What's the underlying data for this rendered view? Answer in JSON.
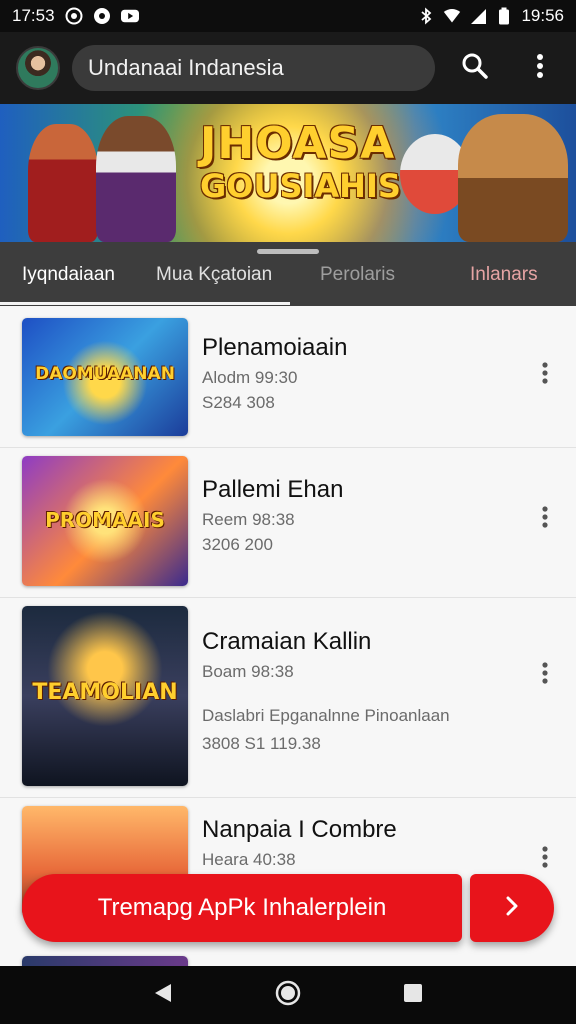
{
  "status_bar": {
    "time": "17:53",
    "battery": "19:56"
  },
  "app_bar": {
    "search_text": "Undanaai Indanesia"
  },
  "banner": {
    "title_line1": "JHOASA",
    "title_line2": "GOUSIAHIS"
  },
  "tabs": [
    {
      "label": "Iyqndaiaan",
      "active": true
    },
    {
      "label": "Mua Kçatoian",
      "active": false
    },
    {
      "label": "Perolaris",
      "active": false
    },
    {
      "label": "Inlanars",
      "active": false
    }
  ],
  "items": [
    {
      "title": "Plenamoiaain",
      "subtitle1": "Alodm 99:30",
      "subtitle2": "S284 308",
      "thumb_text": "DAOMUAANAN"
    },
    {
      "title": "Pallemi Ehan",
      "subtitle1": "Reem 98:38",
      "subtitle2": "3206 200",
      "thumb_text": "PROMAAIS"
    },
    {
      "title": "Cramaian Kallin",
      "subtitle1": "Boam 98:38",
      "subtitle2": "Daslabri Epganalnne Pinoanlaan",
      "subtitle3": "3808 S1 119.38",
      "thumb_text": "TEAMOLIAN"
    },
    {
      "title": "Nanpaia I Combre",
      "subtitle1": "Heara 40:38",
      "thumb_text": ""
    }
  ],
  "cta": {
    "label": "Tremapg ApPk Inhalerplein"
  },
  "icons": {
    "search": "search-icon",
    "more": "more-vert-icon",
    "back": "back-icon",
    "home": "home-icon",
    "recents": "recents-icon",
    "chevron": "chevron-right-icon"
  },
  "colors": {
    "accent": "#e8141b",
    "app_bar": "#1a1a1a",
    "tabs": "#3d3d3d"
  }
}
